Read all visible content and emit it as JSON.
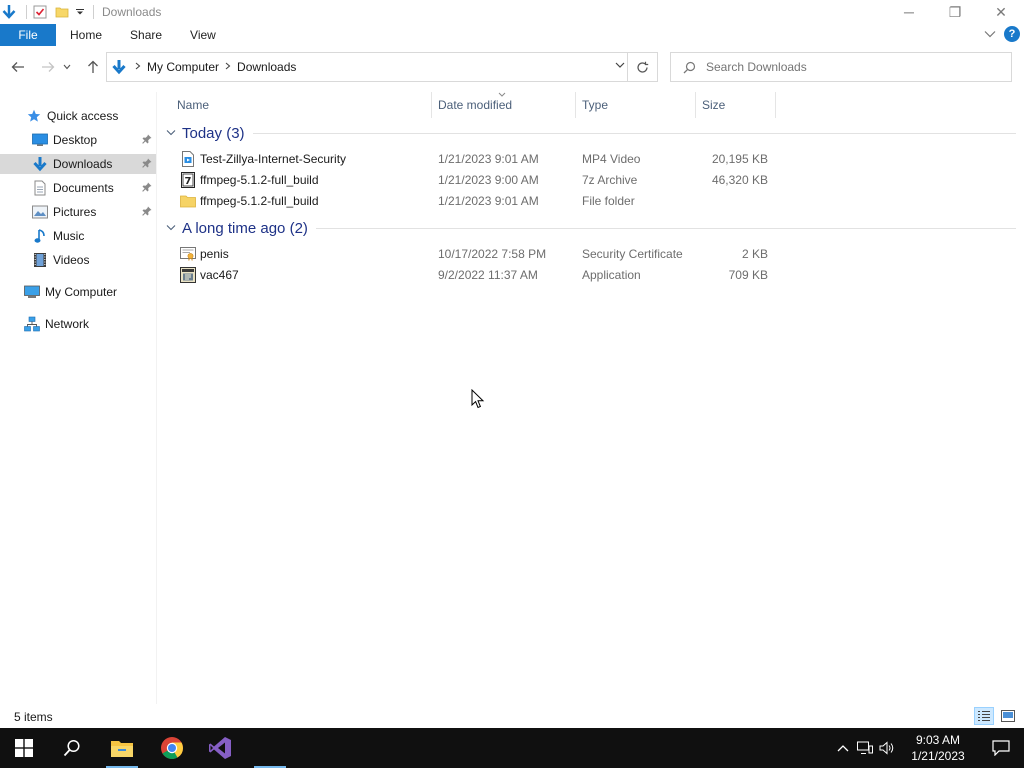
{
  "window": {
    "title": "Downloads",
    "controls": {
      "minimize": "─",
      "restore": "❐",
      "close": "✕"
    }
  },
  "ribbon": {
    "file_label": "File",
    "tabs": [
      "Home",
      "Share",
      "View"
    ],
    "help_label": "?"
  },
  "address": {
    "segments": [
      "My Computer",
      "Downloads"
    ],
    "search_placeholder": "Search Downloads"
  },
  "sidebar": {
    "quick_access": "Quick access",
    "items": [
      {
        "label": "Desktop",
        "icon": "desktop-icon",
        "pinned": true
      },
      {
        "label": "Downloads",
        "icon": "downloads-icon",
        "pinned": true,
        "selected": true
      },
      {
        "label": "Documents",
        "icon": "documents-icon",
        "pinned": true
      },
      {
        "label": "Pictures",
        "icon": "pictures-icon",
        "pinned": true
      },
      {
        "label": "Music",
        "icon": "music-icon"
      },
      {
        "label": "Videos",
        "icon": "videos-icon"
      }
    ],
    "my_computer": "My Computer",
    "network": "Network"
  },
  "columns": {
    "name": "Name",
    "date": "Date modified",
    "type": "Type",
    "size": "Size"
  },
  "groups": [
    {
      "title": "Today (3)",
      "files": [
        {
          "name": "Test-Zillya-Internet-Security",
          "date": "1/21/2023 9:01 AM",
          "type": "MP4 Video",
          "size": "20,195 KB",
          "icon": "video-file-icon"
        },
        {
          "name": "ffmpeg-5.1.2-full_build",
          "date": "1/21/2023 9:00 AM",
          "type": "7z Archive",
          "size": "46,320 KB",
          "icon": "archive-file-icon"
        },
        {
          "name": "ffmpeg-5.1.2-full_build",
          "date": "1/21/2023 9:01 AM",
          "type": "File folder",
          "size": "",
          "icon": "folder-icon"
        }
      ]
    },
    {
      "title": "A long time ago (2)",
      "files": [
        {
          "name": "penis",
          "date": "10/17/2022 7:58 PM",
          "type": "Security Certificate",
          "size": "2 KB",
          "icon": "certificate-file-icon"
        },
        {
          "name": "vac467",
          "date": "9/2/2022 11:37 AM",
          "type": "Application",
          "size": "709 KB",
          "icon": "application-file-icon"
        }
      ]
    }
  ],
  "status": {
    "items_count": "5 items"
  },
  "taskbar": {
    "time": "9:03 AM",
    "date": "1/21/2023"
  },
  "colors": {
    "accent": "#1979ca",
    "group_title": "#1e3287",
    "header_text": "#4c607a",
    "taskbar": "#101010"
  }
}
